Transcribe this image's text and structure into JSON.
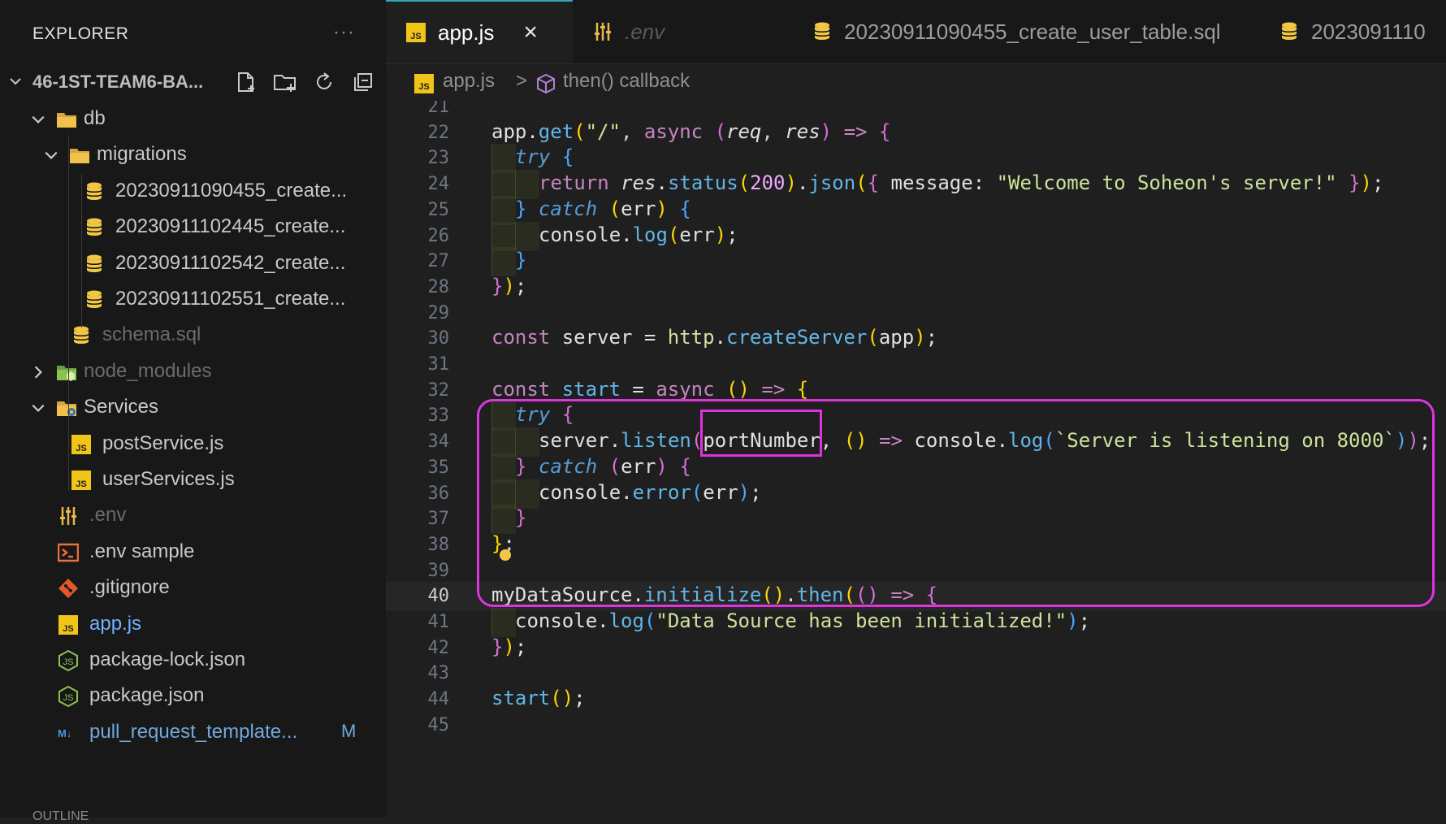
{
  "explorer": {
    "title": "EXPLORER",
    "more": "···",
    "project": "46-1ST-TEAM6-BA...",
    "tree": [
      {
        "label": "db",
        "type": "folder",
        "open": true,
        "depth": 1
      },
      {
        "label": "migrations",
        "type": "folder",
        "open": true,
        "depth": 2
      },
      {
        "label": "20230911090455_create...",
        "type": "db",
        "depth": 3
      },
      {
        "label": "20230911102445_create...",
        "type": "db",
        "depth": 3
      },
      {
        "label": "20230911102542_create...",
        "type": "db",
        "depth": 3
      },
      {
        "label": "20230911102551_create...",
        "type": "db",
        "depth": 3
      },
      {
        "label": "schema.sql",
        "type": "db",
        "depth": 2,
        "dim": true
      },
      {
        "label": "node_modules",
        "type": "node-folder",
        "open": false,
        "depth": 1,
        "dim": true
      },
      {
        "label": "Services",
        "type": "gear-folder",
        "open": true,
        "depth": 1
      },
      {
        "label": "postService.js",
        "type": "js",
        "depth": 2
      },
      {
        "label": "userServices.js",
        "type": "js",
        "depth": 2
      },
      {
        "label": ".env",
        "type": "env",
        "depth": 1,
        "dim": true
      },
      {
        "label": ".env sample",
        "type": "terminal",
        "depth": 1
      },
      {
        "label": ".gitignore",
        "type": "git",
        "depth": 1
      },
      {
        "label": "app.js",
        "type": "js",
        "depth": 1,
        "active": true
      },
      {
        "label": "package-lock.json",
        "type": "node",
        "depth": 1
      },
      {
        "label": "package.json",
        "type": "node",
        "depth": 1
      },
      {
        "label": "pull_request_template...",
        "type": "md",
        "depth": 1,
        "modified": true,
        "badge": "M"
      }
    ],
    "outline": "OUTLINE"
  },
  "tabs": [
    {
      "label": "app.js",
      "active": true,
      "icon": "js"
    },
    {
      "label": ".env",
      "icon": "env"
    },
    {
      "label": "20230911090455_create_user_table.sql",
      "icon": "db"
    },
    {
      "label": "2023091110",
      "icon": "db"
    }
  ],
  "tab_close": "×",
  "breadcrumb": {
    "file": "app.js",
    "symbol": "then() callback",
    "separator": ">"
  },
  "editor": {
    "line_numbers": [
      "21",
      "22",
      "23",
      "24",
      "25",
      "26",
      "27",
      "28",
      "29",
      "30",
      "31",
      "32",
      "33",
      "34",
      "35",
      "36",
      "37",
      "38",
      "39",
      "40",
      "41",
      "42",
      "43",
      "44",
      "45"
    ],
    "current_line": "40"
  },
  "colors": {
    "accent": "#2ea8b7",
    "highlight": "#e033e0",
    "js": "#f0c419",
    "db": "#f2c744"
  }
}
